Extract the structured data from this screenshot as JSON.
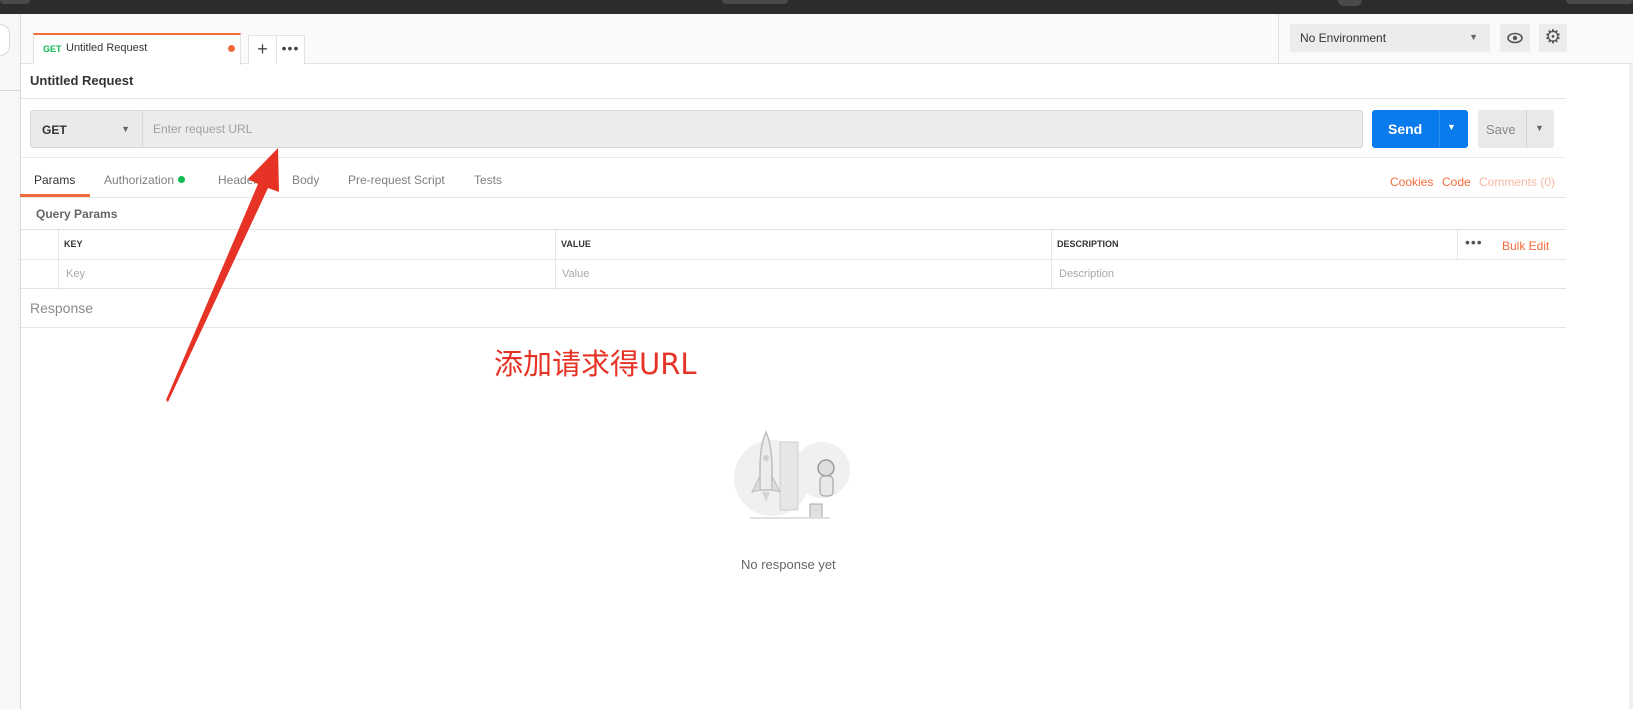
{
  "tab": {
    "method": "GET",
    "name": "Untitled Request"
  },
  "environment": {
    "selected": "No Environment"
  },
  "request": {
    "title": "Untitled Request",
    "method": "GET",
    "url_placeholder": "Enter request URL",
    "send_label": "Send",
    "save_label": "Save"
  },
  "subtabs": [
    "Params",
    "Authorization",
    "Headers",
    "Body",
    "Pre-request Script",
    "Tests"
  ],
  "right_links": {
    "cookies": "Cookies",
    "code": "Code",
    "comments": "Comments (0)"
  },
  "params": {
    "title": "Query Params",
    "columns": [
      "KEY",
      "VALUE",
      "DESCRIPTION"
    ],
    "placeholders": {
      "key": "Key",
      "value": "Value",
      "description": "Description"
    },
    "bulk_edit": "Bulk Edit"
  },
  "response": {
    "label": "Response",
    "empty_text": "No response yet"
  },
  "annotation": {
    "text": "添加请求得URL",
    "color": "#e63325"
  },
  "colors": {
    "accent": "#f26b3a",
    "send": "#097bed",
    "status_dot": "#0cbb52"
  },
  "icons": [
    "plus-icon",
    "more-icon",
    "eye-icon",
    "gear-icon",
    "caret-down-icon",
    "rocket-illustration"
  ]
}
